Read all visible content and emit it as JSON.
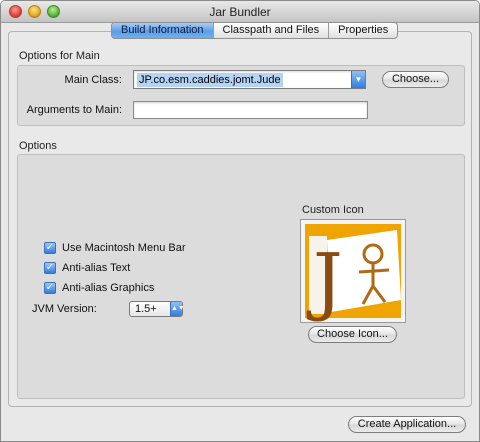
{
  "window": {
    "title": "Jar Bundler"
  },
  "tabs": [
    {
      "label": "Build Information",
      "active": true
    },
    {
      "label": "Classpath and Files",
      "active": false
    },
    {
      "label": "Properties",
      "active": false
    }
  ],
  "main_options": {
    "group_title": "Options for Main",
    "main_class_label": "Main Class:",
    "main_class_value": "JP.co.esm.caddies.jomt.Jude",
    "choose_button": "Choose...",
    "arguments_label": "Arguments to Main:",
    "arguments_value": ""
  },
  "options": {
    "group_title": "Options",
    "checkboxes": [
      {
        "label": "Use Macintosh Menu Bar",
        "checked": true
      },
      {
        "label": "Anti-alias Text",
        "checked": true
      },
      {
        "label": "Anti-alias Graphics",
        "checked": true
      }
    ],
    "jvm_label": "JVM Version:",
    "jvm_value": "1.5+",
    "custom_icon_label": "Custom Icon",
    "icon_letter": "J",
    "choose_icon_button": "Choose Icon..."
  },
  "footer": {
    "create_button": "Create Application..."
  },
  "colors": {
    "accent": "#2f7de0",
    "icon_orange": "#f0a400",
    "icon_brown": "#8a4b12"
  },
  "icons": {
    "checkmark": "check-icon",
    "popup_arrow": "chevron-down-icon"
  }
}
